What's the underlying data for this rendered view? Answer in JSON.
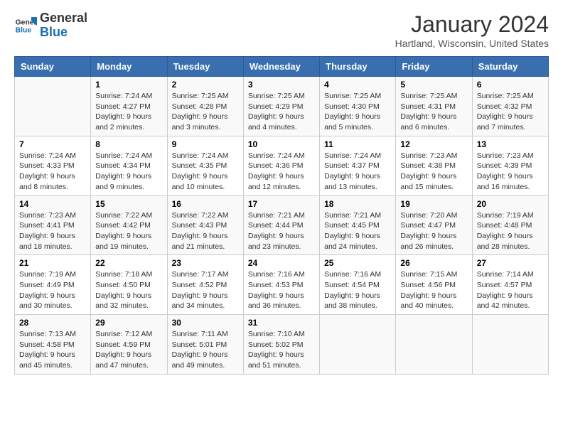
{
  "header": {
    "logo_line1": "General",
    "logo_line2": "Blue",
    "month": "January 2024",
    "location": "Hartland, Wisconsin, United States"
  },
  "weekdays": [
    "Sunday",
    "Monday",
    "Tuesday",
    "Wednesday",
    "Thursday",
    "Friday",
    "Saturday"
  ],
  "weeks": [
    [
      {
        "num": "",
        "info": ""
      },
      {
        "num": "1",
        "info": "Sunrise: 7:24 AM\nSunset: 4:27 PM\nDaylight: 9 hours\nand 2 minutes."
      },
      {
        "num": "2",
        "info": "Sunrise: 7:25 AM\nSunset: 4:28 PM\nDaylight: 9 hours\nand 3 minutes."
      },
      {
        "num": "3",
        "info": "Sunrise: 7:25 AM\nSunset: 4:29 PM\nDaylight: 9 hours\nand 4 minutes."
      },
      {
        "num": "4",
        "info": "Sunrise: 7:25 AM\nSunset: 4:30 PM\nDaylight: 9 hours\nand 5 minutes."
      },
      {
        "num": "5",
        "info": "Sunrise: 7:25 AM\nSunset: 4:31 PM\nDaylight: 9 hours\nand 6 minutes."
      },
      {
        "num": "6",
        "info": "Sunrise: 7:25 AM\nSunset: 4:32 PM\nDaylight: 9 hours\nand 7 minutes."
      }
    ],
    [
      {
        "num": "7",
        "info": "Sunrise: 7:24 AM\nSunset: 4:33 PM\nDaylight: 9 hours\nand 8 minutes."
      },
      {
        "num": "8",
        "info": "Sunrise: 7:24 AM\nSunset: 4:34 PM\nDaylight: 9 hours\nand 9 minutes."
      },
      {
        "num": "9",
        "info": "Sunrise: 7:24 AM\nSunset: 4:35 PM\nDaylight: 9 hours\nand 10 minutes."
      },
      {
        "num": "10",
        "info": "Sunrise: 7:24 AM\nSunset: 4:36 PM\nDaylight: 9 hours\nand 12 minutes."
      },
      {
        "num": "11",
        "info": "Sunrise: 7:24 AM\nSunset: 4:37 PM\nDaylight: 9 hours\nand 13 minutes."
      },
      {
        "num": "12",
        "info": "Sunrise: 7:23 AM\nSunset: 4:38 PM\nDaylight: 9 hours\nand 15 minutes."
      },
      {
        "num": "13",
        "info": "Sunrise: 7:23 AM\nSunset: 4:39 PM\nDaylight: 9 hours\nand 16 minutes."
      }
    ],
    [
      {
        "num": "14",
        "info": "Sunrise: 7:23 AM\nSunset: 4:41 PM\nDaylight: 9 hours\nand 18 minutes."
      },
      {
        "num": "15",
        "info": "Sunrise: 7:22 AM\nSunset: 4:42 PM\nDaylight: 9 hours\nand 19 minutes."
      },
      {
        "num": "16",
        "info": "Sunrise: 7:22 AM\nSunset: 4:43 PM\nDaylight: 9 hours\nand 21 minutes."
      },
      {
        "num": "17",
        "info": "Sunrise: 7:21 AM\nSunset: 4:44 PM\nDaylight: 9 hours\nand 23 minutes."
      },
      {
        "num": "18",
        "info": "Sunrise: 7:21 AM\nSunset: 4:45 PM\nDaylight: 9 hours\nand 24 minutes."
      },
      {
        "num": "19",
        "info": "Sunrise: 7:20 AM\nSunset: 4:47 PM\nDaylight: 9 hours\nand 26 minutes."
      },
      {
        "num": "20",
        "info": "Sunrise: 7:19 AM\nSunset: 4:48 PM\nDaylight: 9 hours\nand 28 minutes."
      }
    ],
    [
      {
        "num": "21",
        "info": "Sunrise: 7:19 AM\nSunset: 4:49 PM\nDaylight: 9 hours\nand 30 minutes."
      },
      {
        "num": "22",
        "info": "Sunrise: 7:18 AM\nSunset: 4:50 PM\nDaylight: 9 hours\nand 32 minutes."
      },
      {
        "num": "23",
        "info": "Sunrise: 7:17 AM\nSunset: 4:52 PM\nDaylight: 9 hours\nand 34 minutes."
      },
      {
        "num": "24",
        "info": "Sunrise: 7:16 AM\nSunset: 4:53 PM\nDaylight: 9 hours\nand 36 minutes."
      },
      {
        "num": "25",
        "info": "Sunrise: 7:16 AM\nSunset: 4:54 PM\nDaylight: 9 hours\nand 38 minutes."
      },
      {
        "num": "26",
        "info": "Sunrise: 7:15 AM\nSunset: 4:56 PM\nDaylight: 9 hours\nand 40 minutes."
      },
      {
        "num": "27",
        "info": "Sunrise: 7:14 AM\nSunset: 4:57 PM\nDaylight: 9 hours\nand 42 minutes."
      }
    ],
    [
      {
        "num": "28",
        "info": "Sunrise: 7:13 AM\nSunset: 4:58 PM\nDaylight: 9 hours\nand 45 minutes."
      },
      {
        "num": "29",
        "info": "Sunrise: 7:12 AM\nSunset: 4:59 PM\nDaylight: 9 hours\nand 47 minutes."
      },
      {
        "num": "30",
        "info": "Sunrise: 7:11 AM\nSunset: 5:01 PM\nDaylight: 9 hours\nand 49 minutes."
      },
      {
        "num": "31",
        "info": "Sunrise: 7:10 AM\nSunset: 5:02 PM\nDaylight: 9 hours\nand 51 minutes."
      },
      {
        "num": "",
        "info": ""
      },
      {
        "num": "",
        "info": ""
      },
      {
        "num": "",
        "info": ""
      }
    ]
  ]
}
